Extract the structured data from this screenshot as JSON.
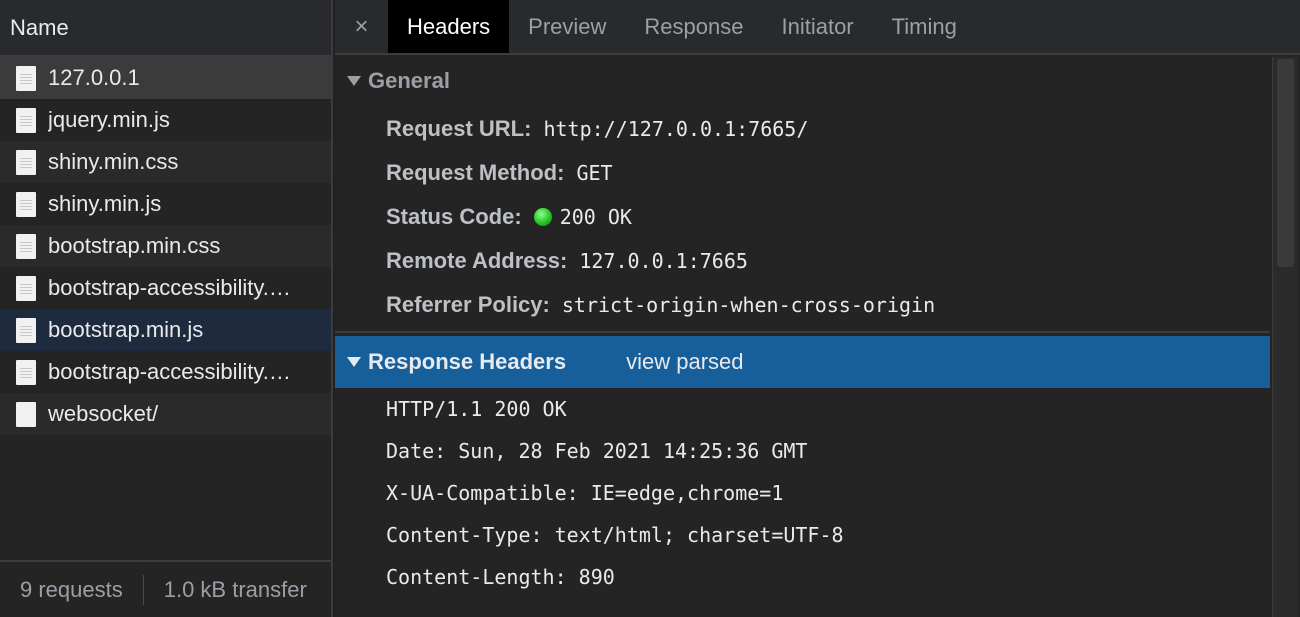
{
  "request_list": {
    "header": "Name",
    "items": [
      {
        "name": "127.0.0.1"
      },
      {
        "name": "jquery.min.js"
      },
      {
        "name": "shiny.min.css"
      },
      {
        "name": "shiny.min.js"
      },
      {
        "name": "bootstrap.min.css"
      },
      {
        "name": "bootstrap-accessibility.…"
      },
      {
        "name": "bootstrap.min.js"
      },
      {
        "name": "bootstrap-accessibility.…"
      },
      {
        "name": "websocket/"
      }
    ],
    "status": {
      "requests": "9 requests",
      "transferred": "1.0 kB transfer"
    }
  },
  "tabs": {
    "close": "×",
    "items": [
      "Headers",
      "Preview",
      "Response",
      "Initiator",
      "Timing"
    ],
    "active": "Headers"
  },
  "general": {
    "title": "General",
    "rows": [
      {
        "key": "Request URL:",
        "value": "http://127.0.0.1:7665/"
      },
      {
        "key": "Request Method:",
        "value": "GET"
      },
      {
        "key": "Status Code:",
        "value": "200 OK"
      },
      {
        "key": "Remote Address:",
        "value": "127.0.0.1:7665"
      },
      {
        "key": "Referrer Policy:",
        "value": "strict-origin-when-cross-origin"
      }
    ]
  },
  "response_headers": {
    "title": "Response Headers",
    "view_parsed": "view parsed",
    "lines": [
      "HTTP/1.1 200 OK",
      "Date: Sun, 28 Feb 2021 14:25:36 GMT",
      "X-UA-Compatible: IE=edge,chrome=1",
      "Content-Type: text/html; charset=UTF-8",
      "Content-Length: 890"
    ]
  },
  "colors": {
    "accent": "#165f9b",
    "status_ok": "#1fbd1f",
    "background": "#242424"
  }
}
